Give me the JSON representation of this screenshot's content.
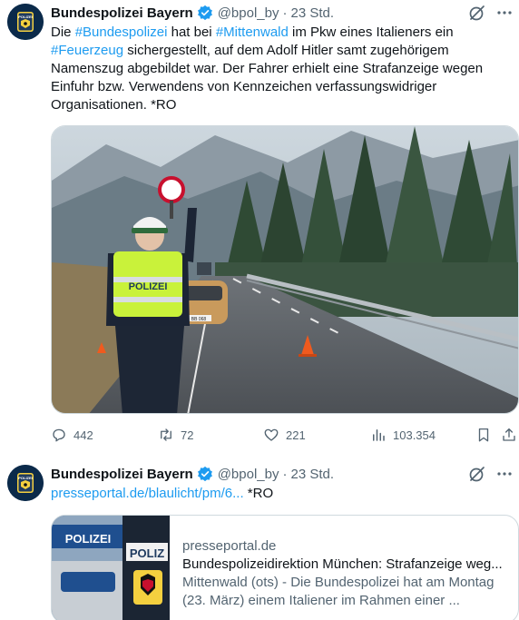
{
  "tweets": [
    {
      "author": "Bundespolizei Bayern",
      "handle": "@bpol_by",
      "time": "23 Std.",
      "avatar_text": "POLIZEI",
      "text_parts": [
        {
          "t": "Die ",
          "c": "text"
        },
        {
          "t": "#Bundespolizei",
          "c": "tag"
        },
        {
          "t": " hat bei ",
          "c": "text"
        },
        {
          "t": "#Mittenwald",
          "c": "tag"
        },
        {
          "t": " im Pkw eines Italieners ein ",
          "c": "text"
        },
        {
          "t": "#Feuerzeug",
          "c": "tag"
        },
        {
          "t": " sichergestellt, auf dem Adolf Hitler samt zugehörigem Namenszug abgebildet war. Der Fahrer erhielt eine Strafanzeige wegen Einfuhr bzw. Verwendens von Kennzeichen verfassungswidriger Organisationen. *RO",
          "c": "text"
        }
      ],
      "image": {
        "vest_text": "POLIZEI",
        "plate_text": "BB 068"
      },
      "metrics": {
        "replies": "442",
        "reposts": "72",
        "likes": "221",
        "views": "103.354"
      }
    },
    {
      "author": "Bundespolizei Bayern",
      "handle": "@bpol_by",
      "time": "23 Std.",
      "avatar_text": "POLIZEI",
      "link_text": "presseportal.de/blaulicht/pm/6...",
      "suffix": " *RO",
      "card": {
        "image_text_top": "POLIZEI",
        "image_text_side": "POLIZ",
        "domain": "presseportal.de",
        "title": "Bundespolizeidirektion München: Strafanzeige weg...",
        "description": "Mittenwald (ots) - Die Bundespolizei hat am Montag (23. März) einem Italiener im Rahmen einer ..."
      }
    }
  ],
  "colors": {
    "accent": "#1d9bf0",
    "muted": "#536471",
    "text": "#0f1419",
    "border": "#cfd9de"
  },
  "icons": [
    "verified-badge-icon",
    "grok-icon",
    "more-icon",
    "reply-icon",
    "repost-icon",
    "like-icon",
    "views-icon",
    "bookmark-icon",
    "share-icon"
  ]
}
